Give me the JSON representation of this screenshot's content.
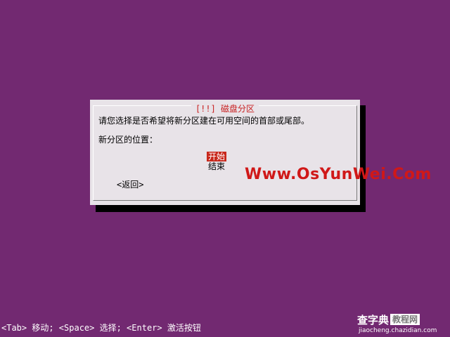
{
  "dialog": {
    "title": "[!!] 磁盘分区",
    "question": "请您选择是否希望将新分区建在可用空间的首部或尾部。",
    "position_label": "新分区的位置：",
    "options": [
      {
        "label": "开始",
        "selected": true
      },
      {
        "label": "结束",
        "selected": false
      }
    ],
    "back_label": "<返回>"
  },
  "statusbar": {
    "text": "<Tab> 移动; <Space> 选择; <Enter> 激活按钮"
  },
  "watermark": {
    "text": "Www.OsYunWei.Com"
  },
  "site_logo": {
    "main": "查字典",
    "box": "教程网",
    "url": "jiaocheng.chazidian.com"
  },
  "colors": {
    "background": "#722971",
    "dialog": "#e8e3e8",
    "accent": "#c8281c",
    "watermark": "#d01818"
  }
}
